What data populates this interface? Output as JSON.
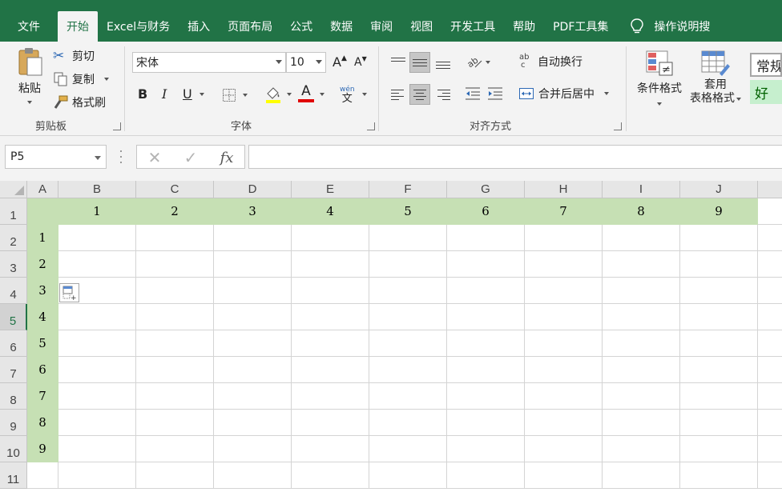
{
  "menu": {
    "tabs": [
      "文件",
      "开始",
      "Excel与财务",
      "插入",
      "页面布局",
      "公式",
      "数据",
      "审阅",
      "视图",
      "开发工具",
      "帮助",
      "PDF工具集"
    ],
    "active_tab": "开始",
    "tell_me": "操作说明搜"
  },
  "ribbon": {
    "clipboard": {
      "paste": "粘贴",
      "cut": "剪切",
      "copy": "复制",
      "format_painter": "格式刷",
      "label": "剪贴板"
    },
    "font": {
      "name": "宋体",
      "size": "10",
      "bold": "B",
      "italic": "I",
      "underline": "U",
      "grow": "A",
      "shrink": "A",
      "font_color_letter": "A",
      "phonetic_top": "wén",
      "phonetic_bottom": "文",
      "label": "字体"
    },
    "alignment": {
      "wrap": "自动换行",
      "merge": "合并后居中",
      "wrap_glyph_top": "ab",
      "wrap_glyph_bottom": "c",
      "label": "对齐方式"
    },
    "styles": {
      "conditional": "条件格式",
      "format_table_line1": "套用",
      "format_table_line2": "表格格式",
      "style_normal": "常规",
      "style_good": "好"
    },
    "colors": {
      "accent": "#217346",
      "header_fill": "#c6e0b4",
      "good_fill": "#c6efce",
      "font_color": "#e00000",
      "fill_color": "#ffff00"
    }
  },
  "formula_bar": {
    "name_box": "P5",
    "cancel": "✕",
    "enter": "✓",
    "fx": "fx",
    "formula": ""
  },
  "sheet": {
    "columns": [
      "A",
      "B",
      "C",
      "D",
      "E",
      "F",
      "G",
      "H",
      "I",
      "J"
    ],
    "rows": [
      "1",
      "2",
      "3",
      "4",
      "5",
      "6",
      "7",
      "8",
      "9",
      "10",
      "11"
    ],
    "active_row": "5",
    "row1_values": [
      "",
      "1",
      "2",
      "3",
      "4",
      "5",
      "6",
      "7",
      "8",
      "9"
    ],
    "colA_values": [
      "",
      "1",
      "2",
      "3",
      "4",
      "5",
      "6",
      "7",
      "8",
      "9",
      ""
    ]
  }
}
